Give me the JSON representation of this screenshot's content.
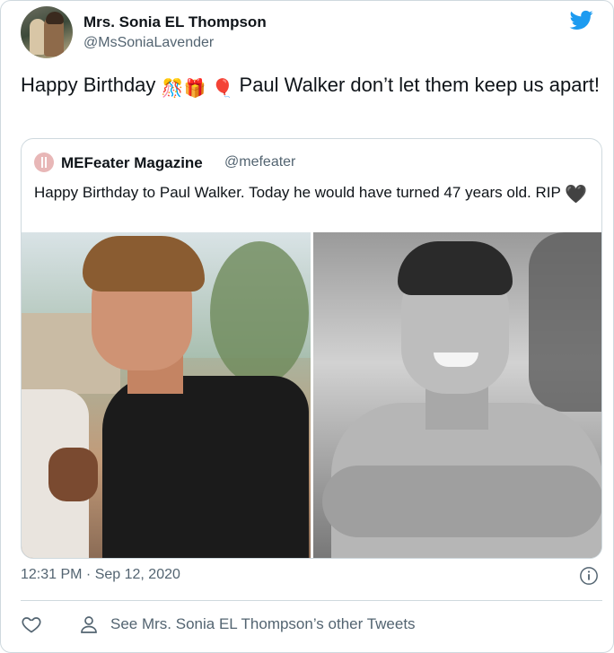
{
  "author": {
    "name": "Mrs. Sonia EL Thompson",
    "handle": "@MsSoniaLavender"
  },
  "tweet": {
    "text_start": "Happy Birthday",
    "text_end": "Paul Walker don’t let them keep us apart!",
    "emojis": [
      "🎊",
      "🎁",
      "🎈"
    ]
  },
  "quoted_tweet": {
    "name": "MEFeater Magazine",
    "handle": "@mefeater",
    "text": "Happy Birthday to Paul Walker. Today he would have turned 47 years old. RIP",
    "emoji": "🖤"
  },
  "meta": {
    "timestamp": "12:31 PM · Sep 12, 2020"
  },
  "actions": {
    "other_tweets_link": "See Mrs. Sonia EL Thompson’s other Tweets"
  },
  "colors": {
    "twitter_blue": "#1d9bf0",
    "muted_text": "#536471",
    "border": "#cfd9de"
  },
  "icons": [
    "twitter-bird-icon",
    "info-icon",
    "heart-icon",
    "person-icon"
  ]
}
